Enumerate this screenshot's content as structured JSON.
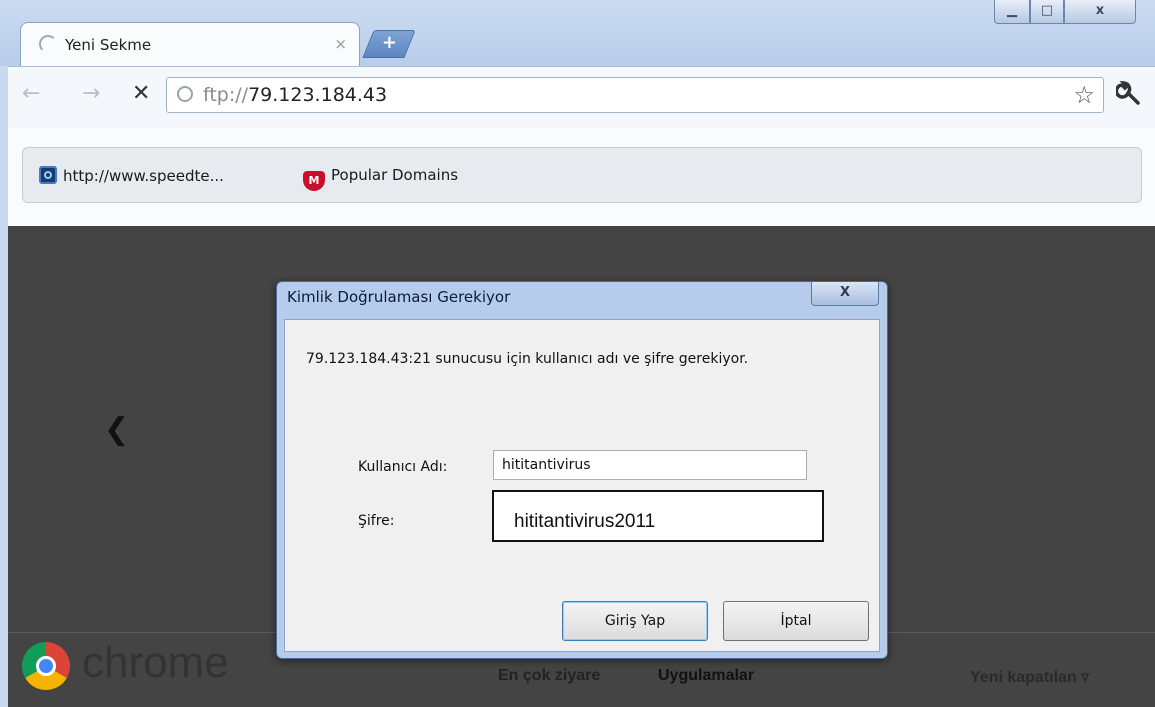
{
  "browser": {
    "tab": {
      "title": "Yeni Sekme",
      "close": "×"
    },
    "new_tab": "+",
    "window_controls": {
      "minimize": "▁",
      "maximize": "□",
      "close": "x"
    },
    "nav": {
      "back": "←",
      "forward": "→",
      "stop": "✕"
    },
    "address": {
      "scheme": "ftp://",
      "host": "79.123.184.43"
    },
    "star": "☆",
    "wrench": "🔧"
  },
  "bookmarks": [
    {
      "label": "http://www.speedte...",
      "icon": "speedtest-icon"
    },
    {
      "label": "Popular Domains",
      "icon": "mcafee-icon",
      "icon_text": "M"
    }
  ],
  "new_tab_page": {
    "pager": "❮",
    "brand": "chrome",
    "footer": {
      "most_visited": "En çok ziyare",
      "apps": "Uygulamalar",
      "recently_closed": "Yeni kapatılan ▿"
    }
  },
  "dialog": {
    "title": "Kimlik Doğrulaması Gerekiyor",
    "close": "X",
    "message": "79.123.184.43:21 sunucusu için kullanıcı adı ve şifre gerekiyor.",
    "username_label": "Kullanıcı Adı:",
    "username_value": "hititantivirus",
    "password_label": "Şifre:",
    "password_value": "hititantivirus2011",
    "ok_button": "Giriş Yap",
    "cancel_button": "İptal"
  }
}
